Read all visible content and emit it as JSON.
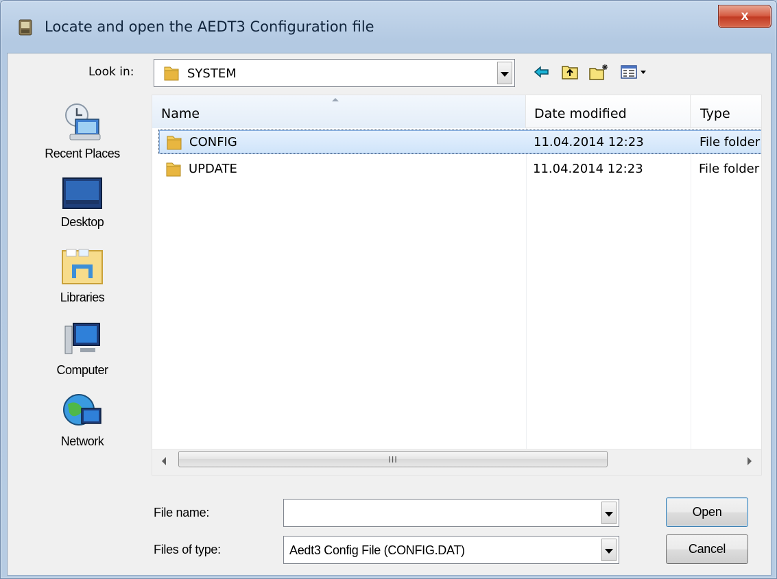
{
  "window": {
    "title": "Locate and open the AEDT3 Configuration file",
    "close_label": "x"
  },
  "lookin": {
    "label": "Look in:",
    "value": "SYSTEM"
  },
  "toolbar": {
    "icons": [
      "back-arrow-icon",
      "up-folder-icon",
      "new-folder-icon",
      "view-menu-icon"
    ]
  },
  "places": [
    {
      "label": "Recent Places",
      "icon": "recent-places-icon"
    },
    {
      "label": "Desktop",
      "icon": "desktop-icon"
    },
    {
      "label": "Libraries",
      "icon": "libraries-icon"
    },
    {
      "label": "Computer",
      "icon": "computer-icon"
    },
    {
      "label": "Network",
      "icon": "network-icon"
    }
  ],
  "filelist": {
    "columns": [
      "Name",
      "Date modified",
      "Type"
    ],
    "rows": [
      {
        "name": "CONFIG",
        "date": "11.04.2014 12:23",
        "type": "File folder",
        "selected": true
      },
      {
        "name": "UPDATE",
        "date": "11.04.2014 12:23",
        "type": "File folder",
        "selected": false
      }
    ],
    "scroll_thumb_grip": "III"
  },
  "form": {
    "filename_label": "File name:",
    "filename_value": "",
    "filetype_label": "Files of type:",
    "filetype_value": "Aedt3 Config File (CONFIG.DAT)"
  },
  "buttons": {
    "open": "Open",
    "cancel": "Cancel"
  },
  "colors": {
    "title_bar": "#b9cde4",
    "close_button": "#c9432b",
    "selection": "#cfe4fa",
    "folder": "#e8b640"
  }
}
